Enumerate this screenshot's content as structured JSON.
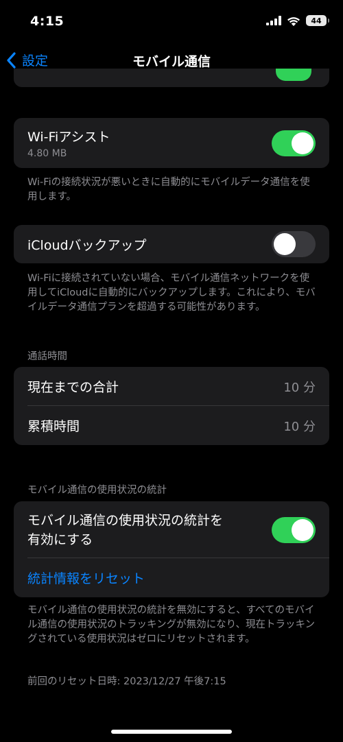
{
  "status_bar": {
    "time": "4:15",
    "battery": "44"
  },
  "nav": {
    "back_label": "設定",
    "title": "モバイル通信"
  },
  "wifi_assist": {
    "label": "Wi-Fiアシスト",
    "usage": "4.80 MB",
    "enabled": true,
    "footer": "Wi-Fiの接続状況が悪いときに自動的にモバイルデータ通信を使用します。"
  },
  "icloud_backup": {
    "label": "iCloudバックアップ",
    "enabled": false,
    "footer": "Wi-Fiに接続されていない場合、モバイル通信ネットワークを使用してiCloudに自動的にバックアップします。これにより、モバイルデータ通信プランを超過する可能性があります。"
  },
  "call_time": {
    "header": "通話時間",
    "rows": [
      {
        "label": "現在までの合計",
        "value": "10 分"
      },
      {
        "label": "累積時間",
        "value": "10 分"
      }
    ]
  },
  "usage_stats": {
    "header": "モバイル通信の使用状況の統計",
    "toggle_label_line1": "モバイル通信の使用状況の統計を",
    "toggle_label_line2": "有効にする",
    "enabled": true,
    "reset_label": "統計情報をリセット",
    "footer": "モバイル通信の使用状況の統計を無効にすると、すべてのモバイル通信の使用状況のトラッキングが無効になり、現在トラッキングされている使用状況はゼロにリセットされます。",
    "last_reset": "前回のリセット日時: 2023/12/27 午後7:15"
  },
  "colors": {
    "accent": "#0a84ff",
    "toggle_on": "#30d158",
    "toggle_off": "#39393d",
    "card": "#1c1c1e",
    "secondary_text": "#8e8e93"
  }
}
